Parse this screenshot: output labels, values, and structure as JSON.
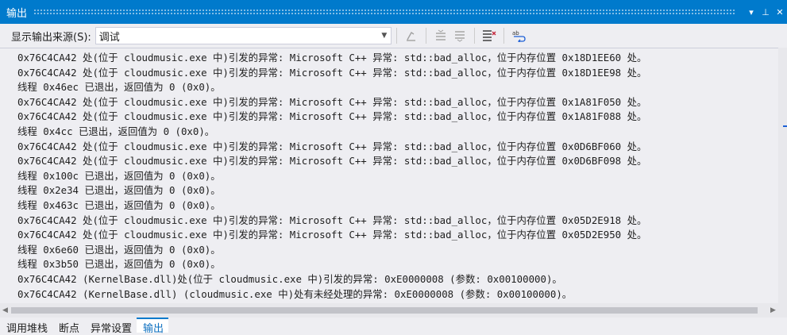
{
  "window": {
    "title": "输出",
    "dropdown_glyph": "▾",
    "pin_glyph": "⊥",
    "close_glyph": "✕"
  },
  "toolbar": {
    "source_label": "显示输出来源(S):",
    "source_value": "调试",
    "icons": [
      "clear-all-icon",
      "previous-message-icon",
      "next-message-icon",
      "clear-icon",
      "word-wrap-icon"
    ]
  },
  "output": {
    "lines": [
      "0x76C4CA42 处(位于 cloudmusic.exe 中)引发的异常: Microsoft C++ 异常: std::bad_alloc，位于内存位置 0x18D1EE60 处。",
      "0x76C4CA42 处(位于 cloudmusic.exe 中)引发的异常: Microsoft C++ 异常: std::bad_alloc，位于内存位置 0x18D1EE98 处。",
      "线程 0x46ec 已退出，返回值为 0 (0x0)。",
      "0x76C4CA42 处(位于 cloudmusic.exe 中)引发的异常: Microsoft C++ 异常: std::bad_alloc，位于内存位置 0x1A81F050 处。",
      "0x76C4CA42 处(位于 cloudmusic.exe 中)引发的异常: Microsoft C++ 异常: std::bad_alloc，位于内存位置 0x1A81F088 处。",
      "线程 0x4cc 已退出，返回值为 0 (0x0)。",
      "0x76C4CA42 处(位于 cloudmusic.exe 中)引发的异常: Microsoft C++ 异常: std::bad_alloc，位于内存位置 0x0D6BF060 处。",
      "0x76C4CA42 处(位于 cloudmusic.exe 中)引发的异常: Microsoft C++ 异常: std::bad_alloc，位于内存位置 0x0D6BF098 处。",
      "线程 0x100c 已退出，返回值为 0 (0x0)。",
      "线程 0x2e34 已退出，返回值为 0 (0x0)。",
      "线程 0x463c 已退出，返回值为 0 (0x0)。",
      "0x76C4CA42 处(位于 cloudmusic.exe 中)引发的异常: Microsoft C++ 异常: std::bad_alloc，位于内存位置 0x05D2E918 处。",
      "0x76C4CA42 处(位于 cloudmusic.exe 中)引发的异常: Microsoft C++ 异常: std::bad_alloc，位于内存位置 0x05D2E950 处。",
      "线程 0x6e60 已退出，返回值为 0 (0x0)。",
      "线程 0x3b50 已退出，返回值为 0 (0x0)。",
      "0x76C4CA42 (KernelBase.dll)处(位于 cloudmusic.exe 中)引发的异常: 0xE0000008 (参数: 0x00100000)。",
      "0x76C4CA42 (KernelBase.dll) (cloudmusic.exe 中)处有未经处理的异常: 0xE0000008 (参数: 0x00100000)。"
    ]
  },
  "tabs": [
    {
      "label": "调用堆栈",
      "active": false
    },
    {
      "label": "断点",
      "active": false
    },
    {
      "label": "异常设置",
      "active": false
    },
    {
      "label": "输出",
      "active": true
    }
  ],
  "colors": {
    "accent": "#007acc",
    "background": "#eeeef2"
  }
}
